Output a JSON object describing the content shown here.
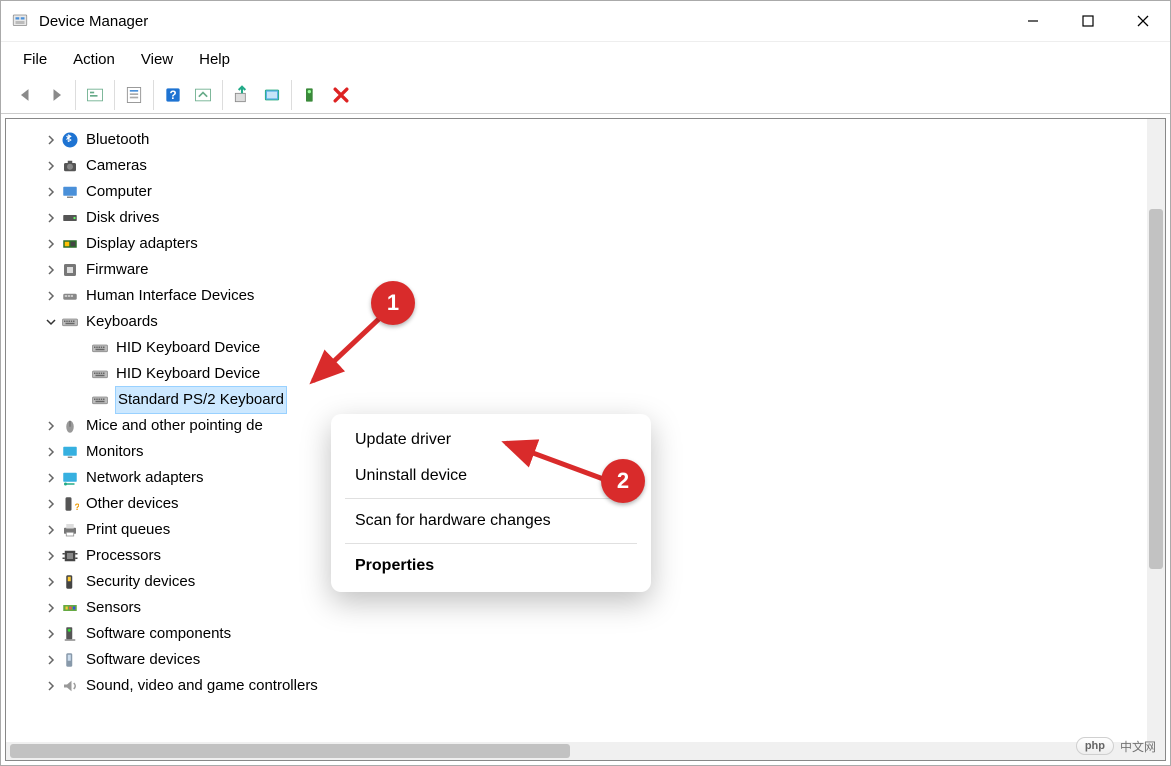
{
  "title": "Device Manager",
  "menubar": [
    "File",
    "Action",
    "View",
    "Help"
  ],
  "toolbar_icons": [
    "nav-back",
    "nav-forward",
    "show-hidden",
    "properties-sheet",
    "help",
    "scan",
    "update-driver",
    "disable",
    "enable",
    "uninstall"
  ],
  "tree": [
    {
      "label": "Bluetooth",
      "icon": "bluetooth",
      "expander": ">",
      "level": 0
    },
    {
      "label": "Cameras",
      "icon": "camera",
      "expander": ">",
      "level": 0
    },
    {
      "label": "Computer",
      "icon": "computer",
      "expander": ">",
      "level": 0
    },
    {
      "label": "Disk drives",
      "icon": "disk",
      "expander": ">",
      "level": 0
    },
    {
      "label": "Display adapters",
      "icon": "display-adapter",
      "expander": ">",
      "level": 0
    },
    {
      "label": "Firmware",
      "icon": "firmware",
      "expander": ">",
      "level": 0
    },
    {
      "label": "Human Interface Devices",
      "icon": "hid",
      "expander": ">",
      "level": 0
    },
    {
      "label": "Keyboards",
      "icon": "keyboard",
      "expander": "v",
      "level": 0
    },
    {
      "label": "HID Keyboard Device",
      "icon": "keyboard",
      "expander": "",
      "level": 1
    },
    {
      "label": "HID Keyboard Device",
      "icon": "keyboard",
      "expander": "",
      "level": 1
    },
    {
      "label": "Standard PS/2 Keyboard",
      "icon": "keyboard",
      "expander": "",
      "level": 1,
      "selected": true
    },
    {
      "label": "Mice and other pointing devices",
      "icon": "mouse",
      "expander": ">",
      "level": 0,
      "truncated": "Mice and other pointing de"
    },
    {
      "label": "Monitors",
      "icon": "monitor",
      "expander": ">",
      "level": 0
    },
    {
      "label": "Network adapters",
      "icon": "network",
      "expander": ">",
      "level": 0
    },
    {
      "label": "Other devices",
      "icon": "other",
      "expander": ">",
      "level": 0
    },
    {
      "label": "Print queues",
      "icon": "printer",
      "expander": ">",
      "level": 0
    },
    {
      "label": "Processors",
      "icon": "processor",
      "expander": ">",
      "level": 0
    },
    {
      "label": "Security devices",
      "icon": "security",
      "expander": ">",
      "level": 0
    },
    {
      "label": "Sensors",
      "icon": "sensor",
      "expander": ">",
      "level": 0
    },
    {
      "label": "Software components",
      "icon": "software-component",
      "expander": ">",
      "level": 0
    },
    {
      "label": "Software devices",
      "icon": "software-device",
      "expander": ">",
      "level": 0
    },
    {
      "label": "Sound, video and game controllers",
      "icon": "sound",
      "expander": ">",
      "level": 0
    }
  ],
  "context_menu": {
    "update": "Update driver",
    "uninstall": "Uninstall device",
    "scan": "Scan for hardware changes",
    "properties": "Properties"
  },
  "annotations": {
    "step1": "1",
    "step2": "2"
  },
  "watermark": {
    "brand": "php",
    "text": "中文网"
  }
}
